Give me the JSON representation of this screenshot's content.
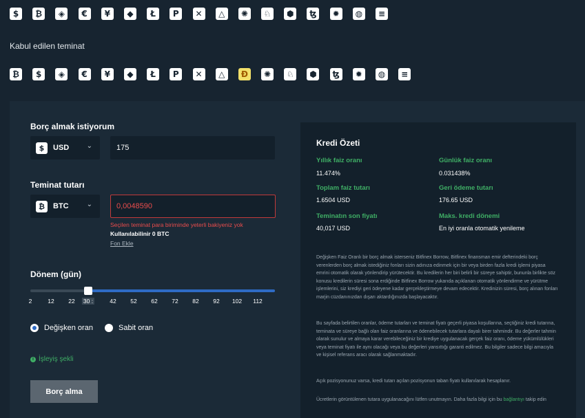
{
  "supported_currencies": [
    {
      "icon": "usd-icon",
      "glyph": "$"
    },
    {
      "icon": "btc-icon",
      "glyph": "₿"
    },
    {
      "icon": "diamond-coin-icon",
      "glyph": "◈"
    },
    {
      "icon": "eur-icon",
      "glyph": "€"
    },
    {
      "icon": "jpy-icon",
      "glyph": "¥"
    },
    {
      "icon": "eth-icon",
      "glyph": "◆"
    },
    {
      "icon": "ltc-icon",
      "glyph": "Ł"
    },
    {
      "icon": "dot-icon",
      "glyph": "P"
    },
    {
      "icon": "xrp-icon",
      "glyph": "✕"
    },
    {
      "icon": "eos-icon",
      "glyph": "△"
    },
    {
      "icon": "ada-icon",
      "glyph": "✺"
    },
    {
      "icon": "unicorn-icon",
      "glyph": "♘"
    },
    {
      "icon": "hexagon-icon",
      "glyph": "⬢"
    },
    {
      "icon": "xtz-icon",
      "glyph": "ꜩ"
    },
    {
      "icon": "bird-icon",
      "glyph": "✹"
    },
    {
      "icon": "globe-icon",
      "glyph": "◍"
    },
    {
      "icon": "stack-icon",
      "glyph": "≡"
    }
  ],
  "accepted_collateral_label": "Kabul edilen teminat",
  "collateral_currencies": [
    {
      "icon": "btc-icon",
      "glyph": "₿"
    },
    {
      "icon": "usd-icon",
      "glyph": "$"
    },
    {
      "icon": "diamond-coin-icon",
      "glyph": "◈"
    },
    {
      "icon": "eur-icon",
      "glyph": "€"
    },
    {
      "icon": "jpy-icon",
      "glyph": "¥"
    },
    {
      "icon": "eth-icon",
      "glyph": "◆"
    },
    {
      "icon": "ltc-icon",
      "glyph": "Ł"
    },
    {
      "icon": "dot-icon",
      "glyph": "P"
    },
    {
      "icon": "xrp-icon",
      "glyph": "✕"
    },
    {
      "icon": "eos-icon",
      "glyph": "△"
    },
    {
      "icon": "doge-icon",
      "glyph": "Ð",
      "highlight": true
    },
    {
      "icon": "ada-icon",
      "glyph": "✺"
    },
    {
      "icon": "unicorn-icon",
      "glyph": "♘"
    },
    {
      "icon": "hexagon-icon",
      "glyph": "⬢"
    },
    {
      "icon": "xtz-icon",
      "glyph": "ꜩ"
    },
    {
      "icon": "bird-icon",
      "glyph": "✹"
    },
    {
      "icon": "globe-icon",
      "glyph": "◍"
    },
    {
      "icon": "stack-icon",
      "glyph": "≡"
    }
  ],
  "borrow": {
    "label": "Borç almak istiyorum",
    "currency": "USD",
    "currency_glyph": "$",
    "amount": "175"
  },
  "collateral": {
    "label": "Teminat tutarı",
    "currency": "BTC",
    "currency_glyph": "₿",
    "amount": "0,0048590",
    "error": "Seçilen teminat para biriminde yeterli bakiyeniz yok",
    "available": "Kullanılabilinir 0 BTC",
    "add_funds": "Fon Ekle"
  },
  "period": {
    "label": "Dönem (gün)",
    "ticks": [
      "2",
      "12",
      "22",
      "30",
      "42",
      "52",
      "62",
      "72",
      "82",
      "92",
      "102",
      "112"
    ],
    "selected_tick": "30 :",
    "min": 2,
    "max": 120,
    "value": 30
  },
  "rate_type": {
    "variable_label": "Değişken oran",
    "fixed_label": "Sabit oran",
    "selected": "variable"
  },
  "how_it_works": "İşleyiş şekli",
  "borrow_button": "Borç alma",
  "summary": {
    "title": "Kredi Özeti",
    "annual_rate_label": "Yıllık faiz oranı",
    "annual_rate": "11.474%",
    "daily_rate_label": "Günlük faiz oranı",
    "daily_rate": "0.031438%",
    "total_interest_label": "Toplam faiz tutarı",
    "total_interest": "1.6504 USD",
    "repayment_label": "Geri ödeme tutarı",
    "repayment": "176.65 USD",
    "last_price_label": "Teminatın son fiyatı",
    "last_price": "40,017 USD",
    "max_term_label": "Maks. kredi dönemi",
    "max_term": "En iyi oranla otomatik yenileme",
    "para1": "Değişken Faiz Oranlı bir borç almak isterseniz Bitfinex Borrow, Bitfinex finansman emir defterindeki borç verenlerden borç almak istediğiniz fonları sizin adınıza edinmek için bir veya birden fazla kredi işlemi piyasa emrini otomatik olarak yönlendirip yürütecektir. Bu kredilerin her biri belirli bir süreye sahiptir, bununla birlikte söz konusu kredilerin süresi sona erdiğinde Bitfinex Borrow yukarıda açıklanan otomatik yönlendirme ve yürütme işlemlerini, siz krediyi geri ödeyene kadar gerçekleştirmeye devam edecektir. Kredinizin süresi, borç alınan fonları marjin cüzdanınızdan dışarı aktardığınızda başlayacaktır.",
    "para2": "Bu sayfada belirtilen oranlar, ödeme tutarları ve teminat fiyatı geçerli piyasa koşullarına, seçtiğiniz kredi tutarına, teminata ve süreye bağlı olan faiz oranlarına ve ödenebilecek tutarlara dayalı birer tahmindir. Bu değerler tahmin olarak sunulur ve almaya karar verebileceğiniz bir krediye uygulanacak gerçek faiz oranı, ödeme yükümlülükleri veya teminat fiyatı ile aynı olacağı veya bu değerleri yansıttığı garanti edilmez. Bu bilgiler sadece bilgi amacıyla ve kişisel referans aracı olarak sağlanmaktadır.",
    "para3": "Açık pozisyonunuz varsa, kredi tutarı açılan pozisyonun taban fiyatı kullanılarak hesaplanır.",
    "para4_text": "Ücretlerin görüntülenen tutara uygulanacağını lütfen unutmayın. Daha fazla bilgi için bu ",
    "para4_link": "bağlantıyı",
    "para4_end": " takip edin"
  }
}
